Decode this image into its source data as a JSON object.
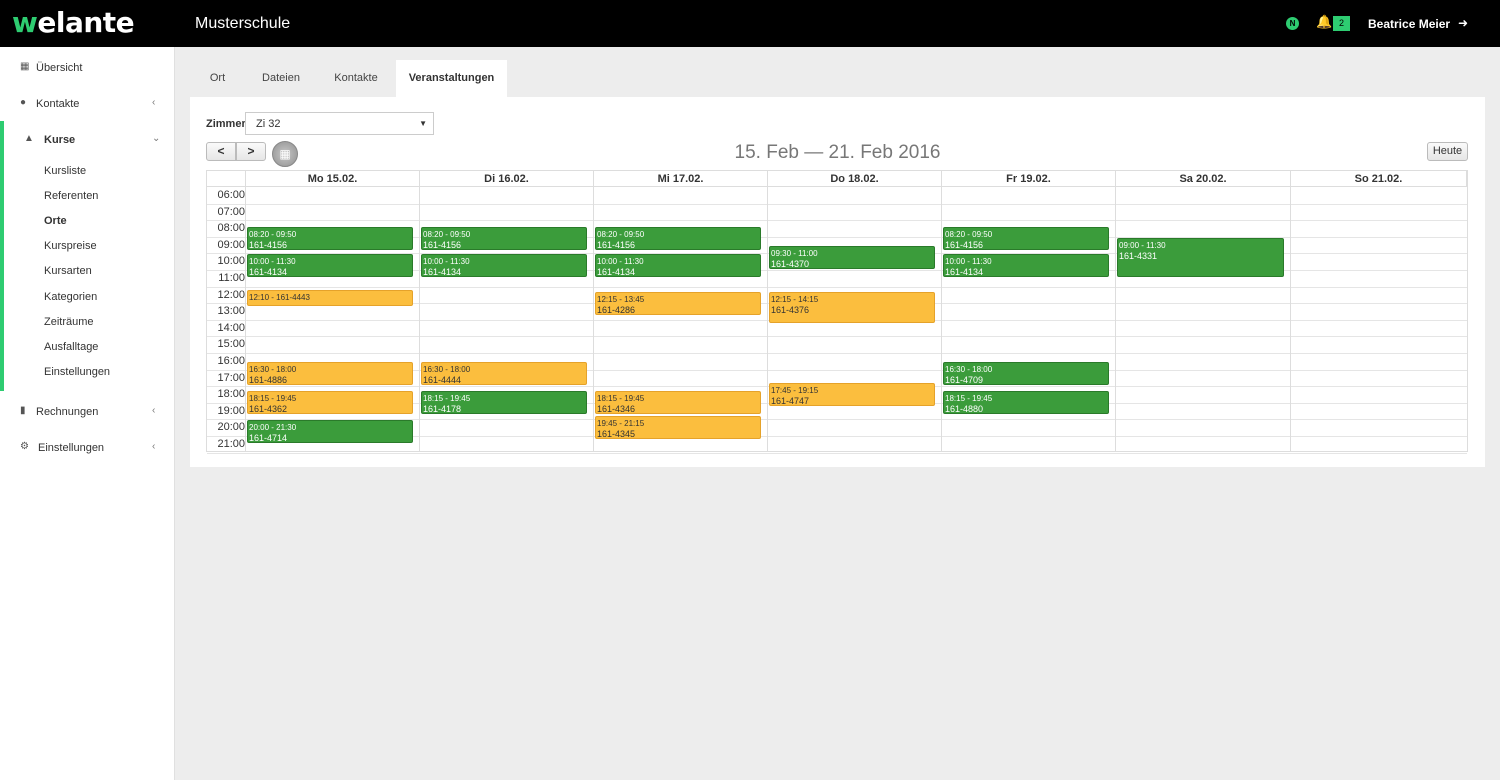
{
  "header": {
    "logo": "welante",
    "school": "Musterschule",
    "status_glyph": "N",
    "notification_count": "2",
    "user": "Beatrice Meier"
  },
  "icons": {
    "dashboard": "grid-icon",
    "contacts": "user-icon",
    "courses": "graduation-cap-icon",
    "invoices": "file-icon",
    "settings": "cogs-icon",
    "notifications": "bell-icon",
    "logout": "logout-icon",
    "calendar": "calendar-icon"
  },
  "colors": {
    "accent": "#2ecc71",
    "event_confirmed": "#3b9c3b",
    "event_pending": "#fbbe3e"
  },
  "sidebar": {
    "items": [
      {
        "label": "Übersicht"
      },
      {
        "label": "Kontakte"
      },
      {
        "label": "Kurse"
      },
      {
        "label": "Rechnungen"
      },
      {
        "label": "Einstellungen"
      }
    ],
    "sub_items": [
      {
        "label": "Kursliste"
      },
      {
        "label": "Referenten"
      },
      {
        "label": "Orte"
      },
      {
        "label": "Kurspreise"
      },
      {
        "label": "Kursarten"
      },
      {
        "label": "Kategorien"
      },
      {
        "label": "Zeiträume"
      },
      {
        "label": "Ausfalltage"
      },
      {
        "label": "Einstellungen"
      }
    ]
  },
  "tabs": [
    {
      "label": "Ort"
    },
    {
      "label": "Dateien"
    },
    {
      "label": "Kontakte"
    },
    {
      "label": "Veranstaltungen"
    }
  ],
  "filter": {
    "label": "Zimmer",
    "value": "Zi 32"
  },
  "calendar": {
    "title": "15. Feb — 21. Feb 2016",
    "prev": "<",
    "next": ">",
    "today": "Heute",
    "days": [
      "Mo 15.02.",
      "Di 16.02.",
      "Mi 17.02.",
      "Do 18.02.",
      "Fr 19.02.",
      "Sa 20.02.",
      "So 21.02."
    ],
    "hours": [
      "06:00",
      "07:00",
      "08:00",
      "09:00",
      "10:00",
      "11:00",
      "12:00",
      "13:00",
      "14:00",
      "15:00",
      "16:00",
      "17:00",
      "18:00",
      "19:00",
      "20:00",
      "21:00"
    ],
    "events": [
      {
        "day": 0,
        "start": "08:20",
        "end": "09:50",
        "time": "08:20 - 09:50",
        "code": "161-4156",
        "status": "green"
      },
      {
        "day": 0,
        "start": "10:00",
        "end": "11:30",
        "time": "10:00 - 11:30",
        "code": "161-4134",
        "status": "green"
      },
      {
        "day": 0,
        "start": "12:10",
        "end": "13:10",
        "time": "12:10 - 161-4443",
        "code": "",
        "status": "orange"
      },
      {
        "day": 0,
        "start": "16:30",
        "end": "18:00",
        "time": "16:30 - 18:00",
        "code": "161-4886",
        "status": "orange"
      },
      {
        "day": 0,
        "start": "18:15",
        "end": "19:45",
        "time": "18:15 - 19:45",
        "code": "161-4362",
        "status": "orange"
      },
      {
        "day": 0,
        "start": "20:00",
        "end": "21:30",
        "time": "20:00 - 21:30",
        "code": "161-4714",
        "status": "green"
      },
      {
        "day": 1,
        "start": "08:20",
        "end": "09:50",
        "time": "08:20 - 09:50",
        "code": "161-4156",
        "status": "green"
      },
      {
        "day": 1,
        "start": "10:00",
        "end": "11:30",
        "time": "10:00 - 11:30",
        "code": "161-4134",
        "status": "green"
      },
      {
        "day": 1,
        "start": "16:30",
        "end": "18:00",
        "time": "16:30 - 18:00",
        "code": "161-4444",
        "status": "orange"
      },
      {
        "day": 1,
        "start": "18:15",
        "end": "19:45",
        "time": "18:15 - 19:45",
        "code": "161-4178",
        "status": "green"
      },
      {
        "day": 2,
        "start": "08:20",
        "end": "09:50",
        "time": "08:20 - 09:50",
        "code": "161-4156",
        "status": "green"
      },
      {
        "day": 2,
        "start": "10:00",
        "end": "11:30",
        "time": "10:00 - 11:30",
        "code": "161-4134",
        "status": "green"
      },
      {
        "day": 2,
        "start": "12:15",
        "end": "13:45",
        "time": "12:15 - 13:45",
        "code": "161-4286",
        "status": "orange"
      },
      {
        "day": 2,
        "start": "18:15",
        "end": "19:45",
        "time": "18:15 - 19:45",
        "code": "161-4346",
        "status": "orange"
      },
      {
        "day": 2,
        "start": "19:45",
        "end": "21:15",
        "time": "19:45 - 21:15",
        "code": "161-4345",
        "status": "orange"
      },
      {
        "day": 3,
        "start": "09:30",
        "end": "11:00",
        "time": "09:30 - 11:00",
        "code": "161-4370",
        "status": "green"
      },
      {
        "day": 3,
        "start": "12:15",
        "end": "14:15",
        "time": "12:15 - 14:15",
        "code": "161-4376",
        "status": "orange"
      },
      {
        "day": 3,
        "start": "17:45",
        "end": "19:15",
        "time": "17:45 - 19:15",
        "code": "161-4747",
        "status": "orange"
      },
      {
        "day": 4,
        "start": "08:20",
        "end": "09:50",
        "time": "08:20 - 09:50",
        "code": "161-4156",
        "status": "green"
      },
      {
        "day": 4,
        "start": "10:00",
        "end": "11:30",
        "time": "10:00 - 11:30",
        "code": "161-4134",
        "status": "green"
      },
      {
        "day": 4,
        "start": "16:30",
        "end": "18:00",
        "time": "16:30 - 18:00",
        "code": "161-4709",
        "status": "green"
      },
      {
        "day": 4,
        "start": "18:15",
        "end": "19:45",
        "time": "18:15 - 19:45",
        "code": "161-4880",
        "status": "green"
      },
      {
        "day": 5,
        "start": "09:00",
        "end": "11:30",
        "time": "09:00 - 11:30",
        "code": "161-4331",
        "status": "green"
      }
    ]
  }
}
